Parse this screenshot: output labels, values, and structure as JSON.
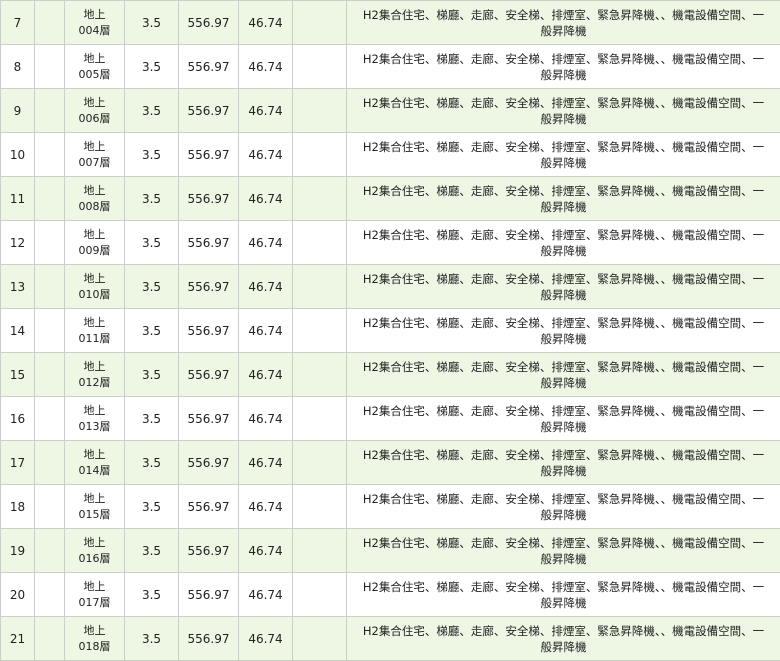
{
  "table": {
    "rows": [
      {
        "no": "7",
        "floor_top": "地上",
        "floor_bottom": "004層",
        "height": "3.5",
        "area": "556.97",
        "area2": "46.74",
        "use_line1": "H2集合住宅、梯廳、走廊、安全梯、排煙室、緊急昇降機、、機電設備空間、一",
        "use_line2": "般昇降機"
      },
      {
        "no": "8",
        "floor_top": "地上",
        "floor_bottom": "005層",
        "height": "3.5",
        "area": "556.97",
        "area2": "46.74",
        "use_line1": "H2集合住宅、梯廳、走廊、安全梯、排煙室、緊急昇降機、、機電設備空間、一",
        "use_line2": "般昇降機"
      },
      {
        "no": "9",
        "floor_top": "地上",
        "floor_bottom": "006層",
        "height": "3.5",
        "area": "556.97",
        "area2": "46.74",
        "use_line1": "H2集合住宅、梯廳、走廊、安全梯、排煙室、緊急昇降機、、機電設備空間、一",
        "use_line2": "般昇降機"
      },
      {
        "no": "10",
        "floor_top": "地上",
        "floor_bottom": "007層",
        "height": "3.5",
        "area": "556.97",
        "area2": "46.74",
        "use_line1": "H2集合住宅、梯廳、走廊、安全梯、排煙室、緊急昇降機、、機電設備空間、一",
        "use_line2": "般昇降機"
      },
      {
        "no": "11",
        "floor_top": "地上",
        "floor_bottom": "008層",
        "height": "3.5",
        "area": "556.97",
        "area2": "46.74",
        "use_line1": "H2集合住宅、梯廳、走廊、安全梯、排煙室、緊急昇降機、、機電設備空間、一",
        "use_line2": "般昇降機"
      },
      {
        "no": "12",
        "floor_top": "地上",
        "floor_bottom": "009層",
        "height": "3.5",
        "area": "556.97",
        "area2": "46.74",
        "use_line1": "H2集合住宅、梯廳、走廊、安全梯、排煙室、緊急昇降機、、機電設備空間、一",
        "use_line2": "般昇降機"
      },
      {
        "no": "13",
        "floor_top": "地上",
        "floor_bottom": "010層",
        "height": "3.5",
        "area": "556.97",
        "area2": "46.74",
        "use_line1": "H2集合住宅、梯廳、走廊、安全梯、排煙室、緊急昇降機、、機電設備空間、一",
        "use_line2": "般昇降機"
      },
      {
        "no": "14",
        "floor_top": "地上",
        "floor_bottom": "011層",
        "height": "3.5",
        "area": "556.97",
        "area2": "46.74",
        "use_line1": "H2集合住宅、梯廳、走廊、安全梯、排煙室、緊急昇降機、、機電設備空間、一",
        "use_line2": "般昇降機"
      },
      {
        "no": "15",
        "floor_top": "地上",
        "floor_bottom": "012層",
        "height": "3.5",
        "area": "556.97",
        "area2": "46.74",
        "use_line1": "H2集合住宅、梯廳、走廊、安全梯、排煙室、緊急昇降機、、機電設備空間、一",
        "use_line2": "般昇降機"
      },
      {
        "no": "16",
        "floor_top": "地上",
        "floor_bottom": "013層",
        "height": "3.5",
        "area": "556.97",
        "area2": "46.74",
        "use_line1": "H2集合住宅、梯廳、走廊、安全梯、排煙室、緊急昇降機、、機電設備空間、一",
        "use_line2": "般昇降機"
      },
      {
        "no": "17",
        "floor_top": "地上",
        "floor_bottom": "014層",
        "height": "3.5",
        "area": "556.97",
        "area2": "46.74",
        "use_line1": "H2集合住宅、梯廳、走廊、安全梯、排煙室、緊急昇降機、、機電設備空間、一",
        "use_line2": "般昇降機"
      },
      {
        "no": "18",
        "floor_top": "地上",
        "floor_bottom": "015層",
        "height": "3.5",
        "area": "556.97",
        "area2": "46.74",
        "use_line1": "H2集合住宅、梯廳、走廊、安全梯、排煙室、緊急昇降機、、機電設備空間、一",
        "use_line2": "般昇降機"
      },
      {
        "no": "19",
        "floor_top": "地上",
        "floor_bottom": "016層",
        "height": "3.5",
        "area": "556.97",
        "area2": "46.74",
        "use_line1": "H2集合住宅、梯廳、走廊、安全梯、排煙室、緊急昇降機、、機電設備空間、一",
        "use_line2": "般昇降機"
      },
      {
        "no": "20",
        "floor_top": "地上",
        "floor_bottom": "017層",
        "height": "3.5",
        "area": "556.97",
        "area2": "46.74",
        "use_line1": "H2集合住宅、梯廳、走廊、安全梯、排煙室、緊急昇降機、、機電設備空間、一",
        "use_line2": "般昇降機"
      },
      {
        "no": "21",
        "floor_top": "地上",
        "floor_bottom": "018層",
        "height": "3.5",
        "area": "556.97",
        "area2": "46.74",
        "use_line1": "H2集合住宅、梯廳、走廊、安全梯、排煙室、緊急昇降機、、機電設備空間、一",
        "use_line2": "般昇降機"
      }
    ]
  }
}
